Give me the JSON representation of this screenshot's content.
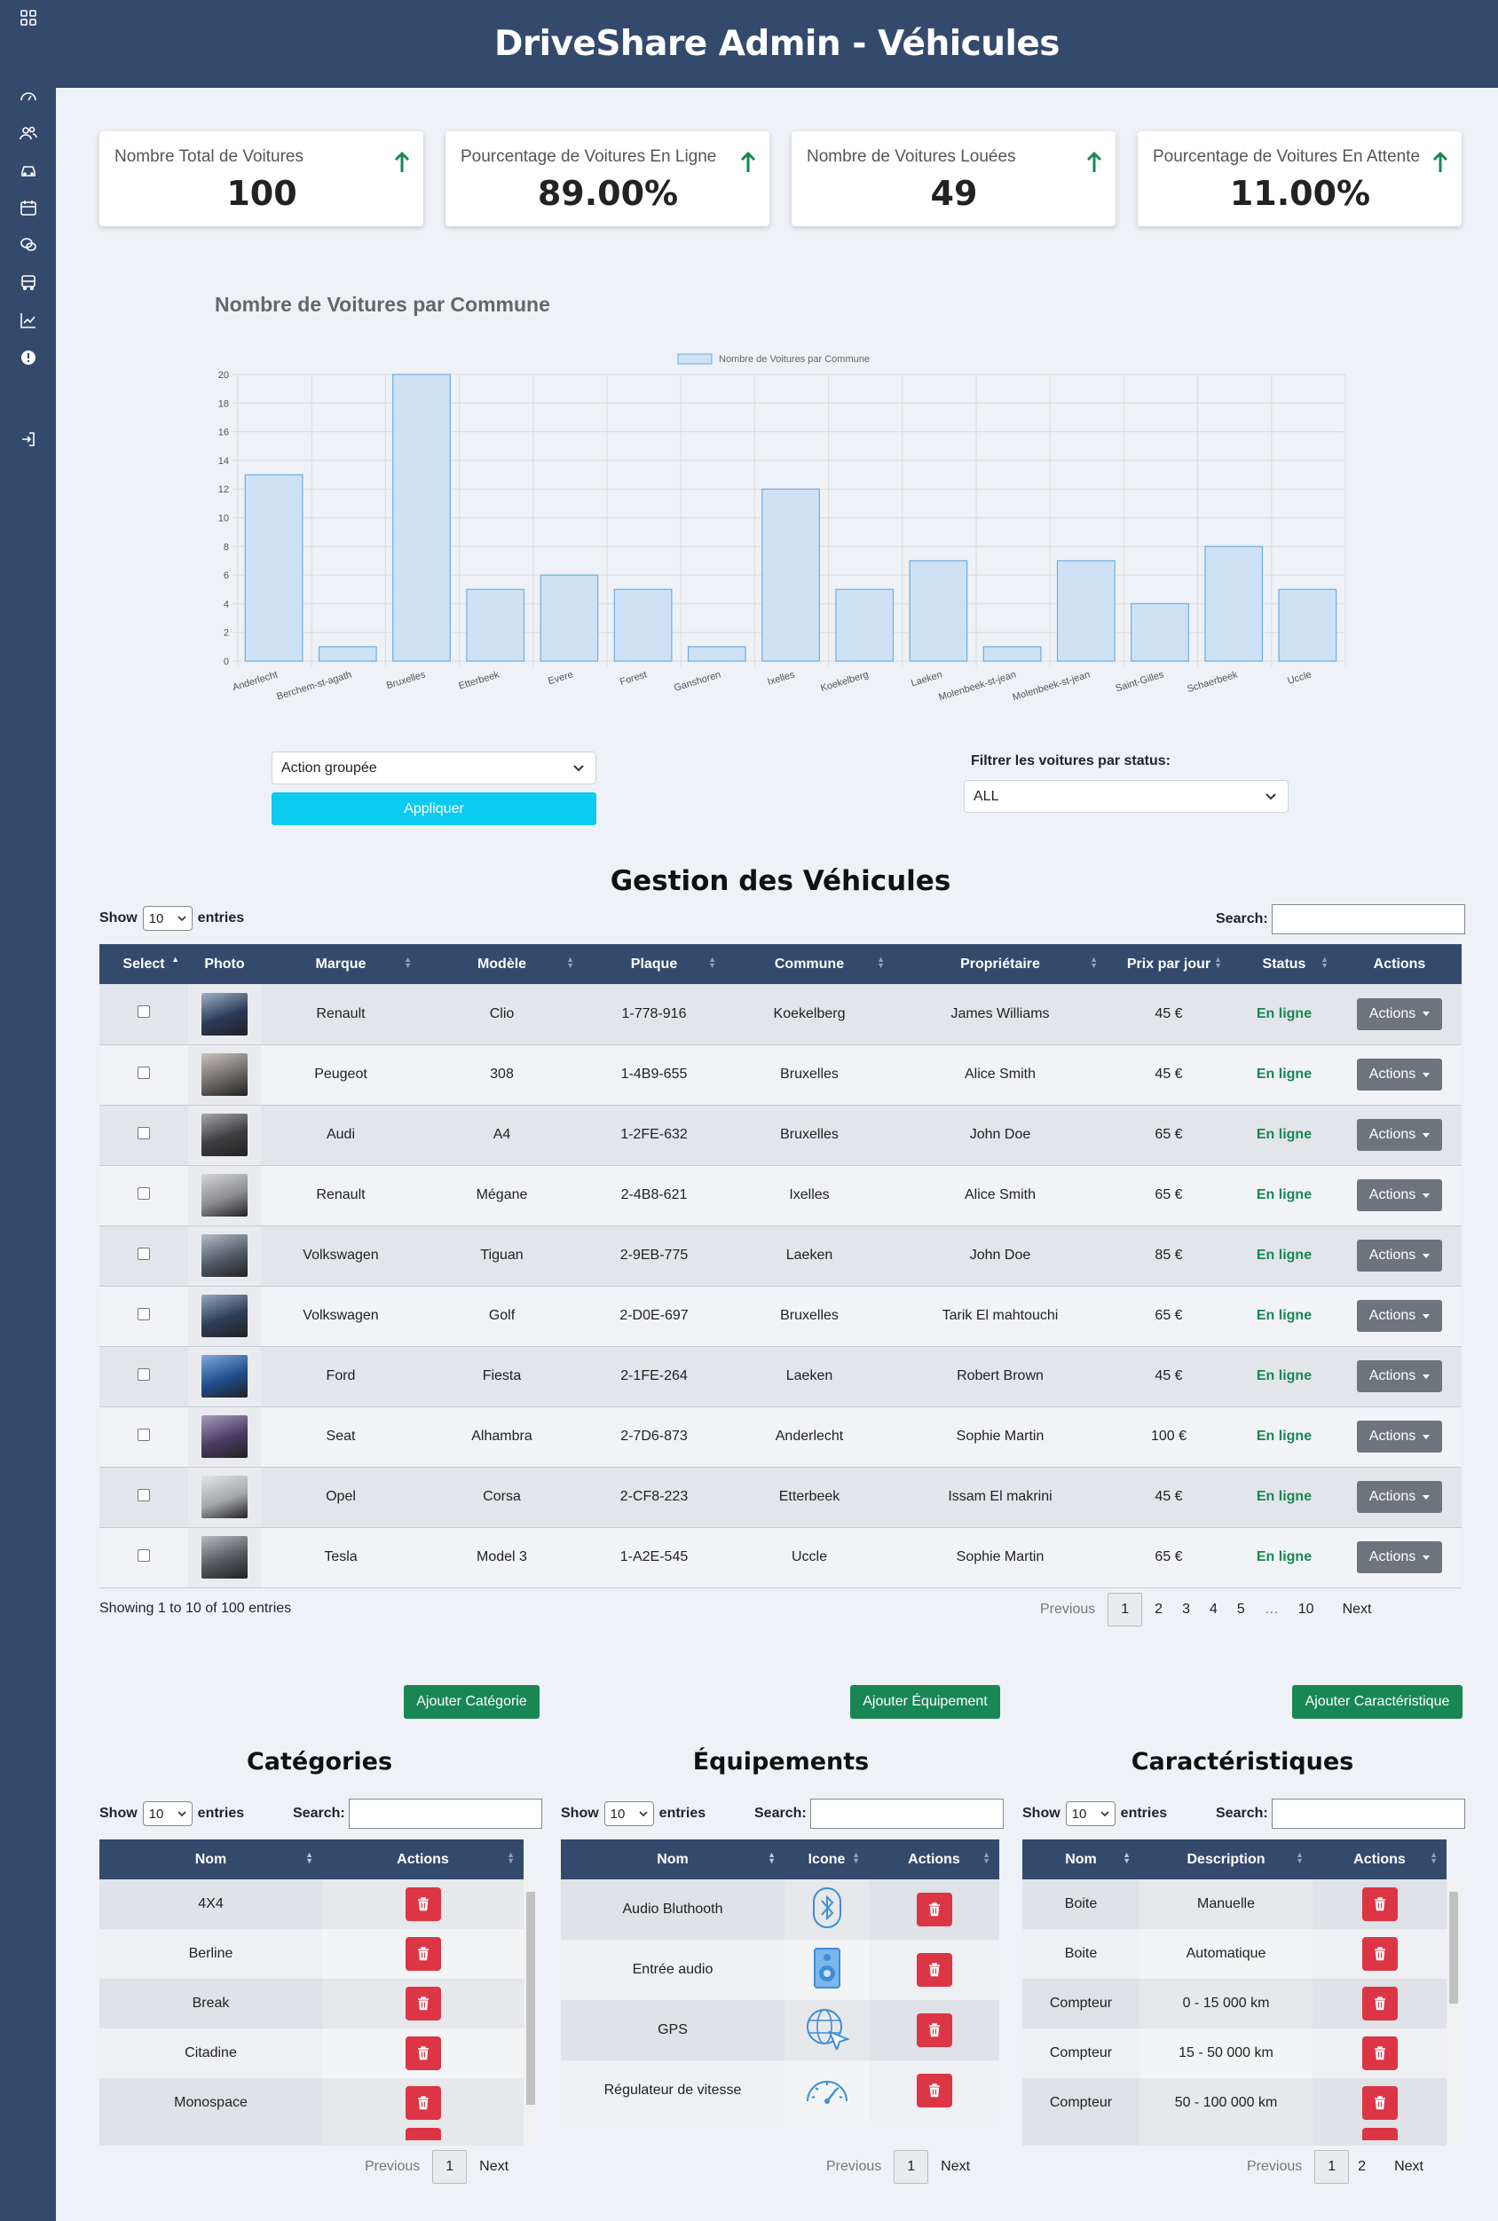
{
  "header": {
    "title": "DriveShare Admin - Véhicules"
  },
  "sidebar": {
    "icons": [
      "grid-icon",
      "dashboard-icon",
      "users-icon",
      "car-icon",
      "calendar-icon",
      "chat-icon",
      "bus-icon",
      "chart-line-icon",
      "alert-icon",
      "logout-icon"
    ]
  },
  "stats": [
    {
      "label": "Nombre Total de Voitures",
      "value": "100"
    },
    {
      "label": "Pourcentage de Voitures En Ligne",
      "value": "89.00%"
    },
    {
      "label": "Nombre de Voitures Louées",
      "value": "49"
    },
    {
      "label": "Pourcentage de Voitures En Attente",
      "value": "11.00%"
    }
  ],
  "chart_title": "Nombre de Voitures par Commune",
  "chart_data": {
    "type": "bar",
    "title": "",
    "legend": "Nombre de Voitures par Commune",
    "legend_position": "top",
    "categories": [
      "Anderlecht",
      "Berchem-st-agath",
      "Bruxelles",
      "Etterbeek",
      "Evere",
      "Forest",
      "Ganshoren",
      "Ixelles",
      "Koekelberg",
      "Laeken",
      "Molenbeek-st-jean",
      "Molenbeek-st-jean",
      "Saint-Gilles",
      "Schaerbeek",
      "Uccle"
    ],
    "values": [
      13,
      1,
      20,
      5,
      6,
      5,
      1,
      12,
      5,
      7,
      1,
      7,
      4,
      8,
      5
    ],
    "ylim": [
      0,
      20
    ],
    "yticks": [
      0,
      2,
      4,
      6,
      8,
      10,
      12,
      14,
      16,
      18,
      20
    ],
    "grid": true,
    "colors": {
      "fill": "#cfe2f5",
      "stroke": "#6aaee3"
    }
  },
  "bulk": {
    "select": "Action groupée",
    "apply": "Appliquer"
  },
  "filter": {
    "label": "Filtrer les voitures par status:",
    "value": "ALL"
  },
  "vehicles": {
    "title": "Gestion des Véhicules",
    "show": "Show",
    "show_value": "10",
    "entries": "entries",
    "search": "Search:",
    "columns": [
      "Select",
      "Photo",
      "Marque",
      "Modèle",
      "Plaque",
      "Commune",
      "Propriétaire",
      "Prix par jour",
      "Status",
      "Actions"
    ],
    "rows": [
      {
        "marque": "Renault",
        "modele": "Clio",
        "plaque": "1-778-916",
        "commune": "Koekelberg",
        "proprio": "James Williams",
        "prix": "45 €",
        "status": "En ligne",
        "action": "Actions"
      },
      {
        "marque": "Peugeot",
        "modele": "308",
        "plaque": "1-4B9-655",
        "commune": "Bruxelles",
        "proprio": "Alice Smith",
        "prix": "45 €",
        "status": "En ligne",
        "action": "Actions"
      },
      {
        "marque": "Audi",
        "modele": "A4",
        "plaque": "1-2FE-632",
        "commune": "Bruxelles",
        "proprio": "John Doe",
        "prix": "65 €",
        "status": "En ligne",
        "action": "Actions"
      },
      {
        "marque": "Renault",
        "modele": "Mégane",
        "plaque": "2-4B8-621",
        "commune": "Ixelles",
        "proprio": "Alice Smith",
        "prix": "65 €",
        "status": "En ligne",
        "action": "Actions"
      },
      {
        "marque": "Volkswagen",
        "modele": "Tiguan",
        "plaque": "2-9EB-775",
        "commune": "Laeken",
        "proprio": "John Doe",
        "prix": "85 €",
        "status": "En ligne",
        "action": "Actions"
      },
      {
        "marque": "Volkswagen",
        "modele": "Golf",
        "plaque": "2-D0E-697",
        "commune": "Bruxelles",
        "proprio": "Tarik El mahtouchi",
        "prix": "65 €",
        "status": "En ligne",
        "action": "Actions"
      },
      {
        "marque": "Ford",
        "modele": "Fiesta",
        "plaque": "2-1FE-264",
        "commune": "Laeken",
        "proprio": "Robert Brown",
        "prix": "45 €",
        "status": "En ligne",
        "action": "Actions"
      },
      {
        "marque": "Seat",
        "modele": "Alhambra",
        "plaque": "2-7D6-873",
        "commune": "Anderlecht",
        "proprio": "Sophie Martin",
        "prix": "100 €",
        "status": "En ligne",
        "action": "Actions"
      },
      {
        "marque": "Opel",
        "modele": "Corsa",
        "plaque": "2-CF8-223",
        "commune": "Etterbeek",
        "proprio": "Issam El makrini",
        "prix": "45 €",
        "status": "En ligne",
        "action": "Actions"
      },
      {
        "marque": "Tesla",
        "modele": "Model 3",
        "plaque": "1-A2E-545",
        "commune": "Uccle",
        "proprio": "Sophie Martin",
        "prix": "65 €",
        "status": "En ligne",
        "action": "Actions"
      }
    ],
    "info": "Showing 1 to 10 of 100 entries",
    "pager": {
      "prev": "Previous",
      "pages": [
        "1",
        "2",
        "3",
        "4",
        "5",
        "…",
        "10"
      ],
      "next": "Next"
    }
  },
  "buttons": {
    "add_cat": "Ajouter Catégorie",
    "add_eq": "Ajouter Équipement",
    "add_car": "Ajouter Caractéristique"
  },
  "categories": {
    "title": "Catégories",
    "show": "Show",
    "show_value": "10",
    "entries": "entries",
    "search": "Search:",
    "columns": [
      "Nom",
      "Actions"
    ],
    "rows": [
      "4X4",
      "Berline",
      "Break",
      "Citadine",
      "Monospace"
    ],
    "pager": {
      "prev": "Previous",
      "page": "1",
      "next": "Next"
    }
  },
  "equipements": {
    "title": "Équipements",
    "show": "Show",
    "show_value": "10",
    "entries": "entries",
    "search": "Search:",
    "columns": [
      "Nom",
      "Icone",
      "Actions"
    ],
    "rows": [
      {
        "nom": "Audio Bluthooth",
        "icon": "bluetooth-icon"
      },
      {
        "nom": "Entrée audio",
        "icon": "speaker-icon"
      },
      {
        "nom": "GPS",
        "icon": "globe-icon"
      },
      {
        "nom": "Régulateur de vitesse",
        "icon": "speedometer-icon"
      }
    ],
    "pager": {
      "prev": "Previous",
      "page": "1",
      "next": "Next"
    }
  },
  "caracteristiques": {
    "title": "Caractéristiques",
    "show": "Show",
    "show_value": "10",
    "entries": "entries",
    "search": "Search:",
    "columns": [
      "Nom",
      "Description",
      "Actions"
    ],
    "rows": [
      {
        "nom": "Boite",
        "desc": "Manuelle"
      },
      {
        "nom": "Boite",
        "desc": "Automatique"
      },
      {
        "nom": "Compteur",
        "desc": "0 - 15 000 km"
      },
      {
        "nom": "Compteur",
        "desc": "15 - 50 000 km"
      },
      {
        "nom": "Compteur",
        "desc": "50 - 100 000 km"
      }
    ],
    "pager": {
      "prev": "Previous",
      "pages": [
        "1",
        "2"
      ],
      "next": "Next"
    }
  },
  "colors": {
    "navy": "#344a6c",
    "green": "#198754",
    "cyan": "#0dcaf0",
    "red": "#dc3545"
  }
}
